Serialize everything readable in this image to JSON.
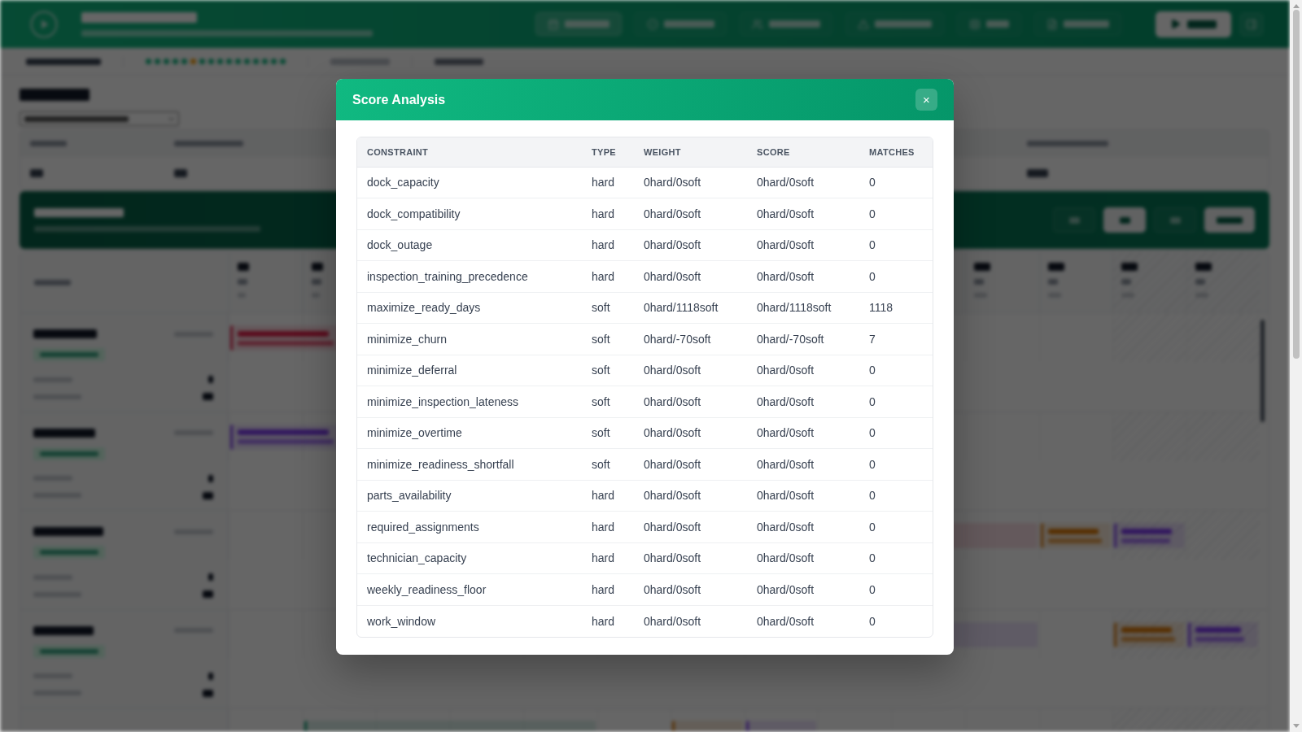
{
  "modal": {
    "title": "Score Analysis",
    "close": "×",
    "columns": [
      "CONSTRAINT",
      "TYPE",
      "WEIGHT",
      "SCORE",
      "MATCHES"
    ],
    "rows": [
      [
        "dock_capacity",
        "hard",
        "0hard/0soft",
        "0hard/0soft",
        "0"
      ],
      [
        "dock_compatibility",
        "hard",
        "0hard/0soft",
        "0hard/0soft",
        "0"
      ],
      [
        "dock_outage",
        "hard",
        "0hard/0soft",
        "0hard/0soft",
        "0"
      ],
      [
        "inspection_training_precedence",
        "hard",
        "0hard/0soft",
        "0hard/0soft",
        "0"
      ],
      [
        "maximize_ready_days",
        "soft",
        "0hard/1118soft",
        "0hard/1118soft",
        "1118"
      ],
      [
        "minimize_churn",
        "soft",
        "0hard/-70soft",
        "0hard/-70soft",
        "7"
      ],
      [
        "minimize_deferral",
        "soft",
        "0hard/0soft",
        "0hard/0soft",
        "0"
      ],
      [
        "minimize_inspection_lateness",
        "soft",
        "0hard/0soft",
        "0hard/0soft",
        "0"
      ],
      [
        "minimize_overtime",
        "soft",
        "0hard/0soft",
        "0hard/0soft",
        "0"
      ],
      [
        "minimize_readiness_shortfall",
        "soft",
        "0hard/0soft",
        "0hard/0soft",
        "0"
      ],
      [
        "parts_availability",
        "hard",
        "0hard/0soft",
        "0hard/0soft",
        "0"
      ],
      [
        "required_assignments",
        "hard",
        "0hard/0soft",
        "0hard/0soft",
        "0"
      ],
      [
        "technician_capacity",
        "hard",
        "0hard/0soft",
        "0hard/0soft",
        "0"
      ],
      [
        "weekly_readiness_floor",
        "hard",
        "0hard/0soft",
        "0hard/0soft",
        "0"
      ],
      [
        "work_window",
        "hard",
        "0hard/0soft",
        "0hard/0soft",
        "0"
      ]
    ]
  }
}
